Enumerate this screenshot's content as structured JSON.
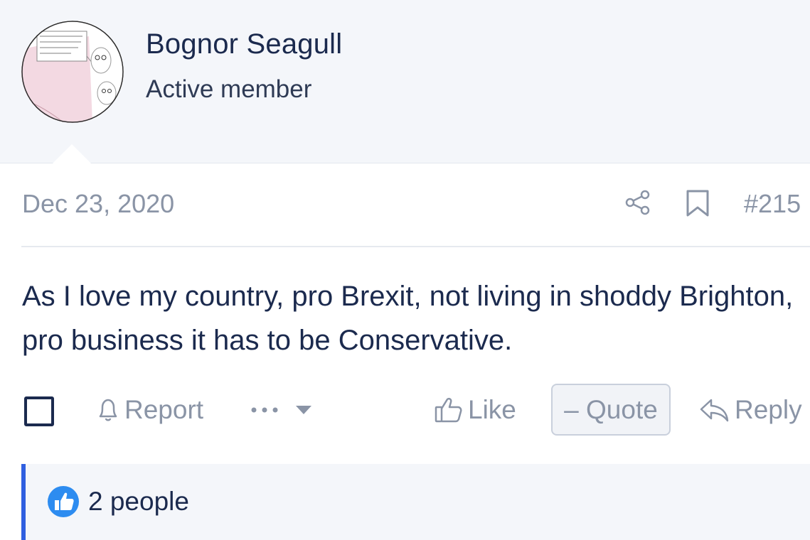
{
  "user": {
    "name": "Bognor Seagull",
    "title": "Active member"
  },
  "post": {
    "date": "Dec 23, 2020",
    "number": "#215",
    "message": "As I love my country, pro Brexit, not living in shoddy Brighton, pro business it has to be Conservative."
  },
  "actions": {
    "report": "Report",
    "like": "Like",
    "quote": "Quote",
    "reply": "Reply"
  },
  "reactions": {
    "summary": "2 people"
  },
  "icons": {
    "share": "share-icon",
    "bookmark": "bookmark-icon",
    "bell": "bell-icon",
    "more": "more-dots-icon",
    "like": "thumbs-up-icon",
    "reply": "reply-arrow-icon",
    "reaction": "like-reaction-icon"
  },
  "colors": {
    "text": "#1b2a4e",
    "muted": "#8a94a6",
    "header_bg": "#f4f6fa",
    "accent": "#2f5fe0"
  }
}
